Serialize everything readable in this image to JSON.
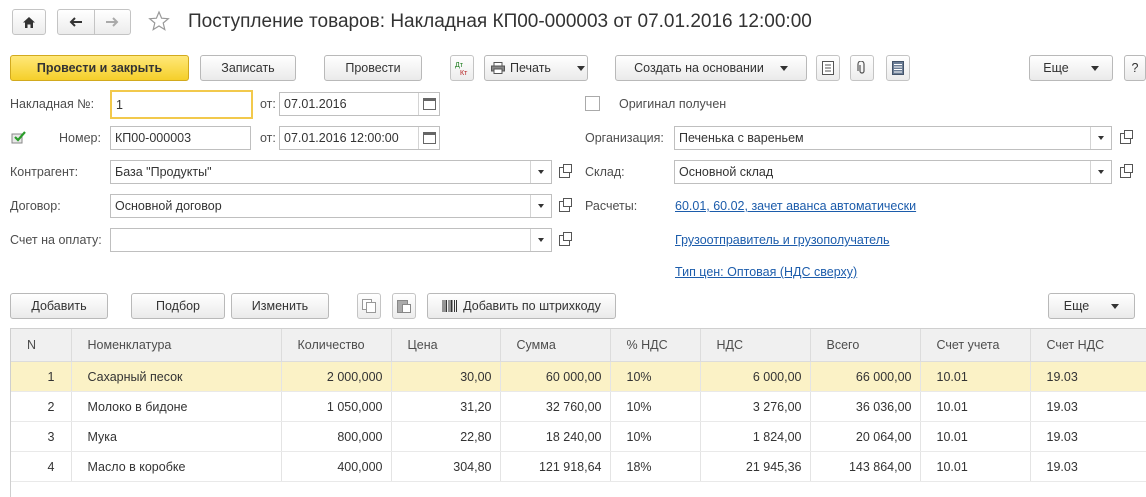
{
  "title": "Поступление товаров: Накладная КП00-000003 от 07.01.2016 12:00:00",
  "toolbar": {
    "post_close": "Провести и закрыть",
    "save": "Записать",
    "post": "Провести",
    "print": "Печать",
    "create_based": "Создать на основании",
    "more": "Еще",
    "help": "?"
  },
  "form": {
    "invoice_no_label": "Накладная №:",
    "invoice_no_value": "1",
    "from_label": "от:",
    "invoice_date": "07.01.2016",
    "original_label": "Оригинал получен",
    "number_label": "Номер:",
    "number_value": "КП00-000003",
    "from_label2": "от:",
    "doc_datetime": "07.01.2016 12:00:00",
    "org_label": "Организация:",
    "org_value": "Печенька с вареньем",
    "contractor_label": "Контрагент:",
    "contractor_value": "База \"Продукты\"",
    "warehouse_label": "Склад:",
    "warehouse_value": "Основной склад",
    "contract_label": "Договор:",
    "contract_value": "Основной договор",
    "settlements_label": "Расчеты:",
    "settlements_link": "60.01, 60.02, зачет аванса автоматически",
    "pay_invoice_label": "Счет на оплату:",
    "pay_invoice_value": "",
    "shipper_link": "Грузоотправитель и грузополучатель",
    "price_type_link": "Тип цен: Оптовая (НДС сверху)"
  },
  "table_toolbar": {
    "add": "Добавить",
    "pick": "Подбор",
    "edit": "Изменить",
    "barcode": "Добавить по штрихкоду",
    "more": "Еще"
  },
  "table": {
    "headers": [
      "N",
      "Номенклатура",
      "Количество",
      "Цена",
      "Сумма",
      "% НДС",
      "НДС",
      "Всего",
      "Счет учета",
      "Счет НДС"
    ],
    "rows": [
      [
        "1",
        "Сахарный песок",
        "2 000,000",
        "30,00",
        "60 000,00",
        "10%",
        "6 000,00",
        "66 000,00",
        "10.01",
        "19.03"
      ],
      [
        "2",
        "Молоко в бидоне",
        "1 050,000",
        "31,20",
        "32 760,00",
        "10%",
        "3 276,00",
        "36 036,00",
        "10.01",
        "19.03"
      ],
      [
        "3",
        "Мука",
        "800,000",
        "22,80",
        "18 240,00",
        "10%",
        "1 824,00",
        "20 064,00",
        "10.01",
        "19.03"
      ],
      [
        "4",
        "Масло в коробке",
        "400,000",
        "304,80",
        "121 918,64",
        "18%",
        "21 945,36",
        "143 864,00",
        "10.01",
        "19.03"
      ]
    ]
  }
}
